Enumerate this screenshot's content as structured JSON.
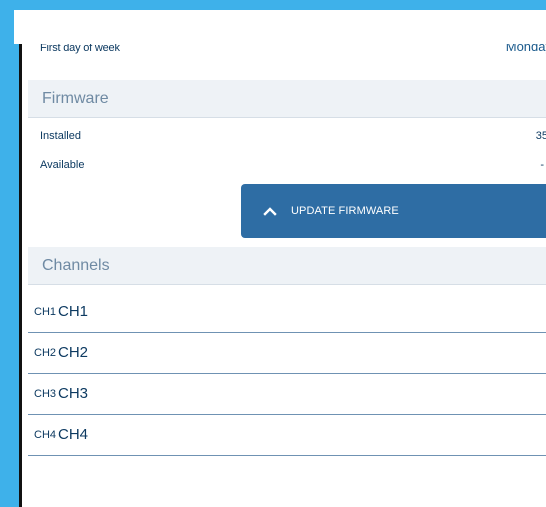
{
  "settings": {
    "first_day_label": "First day of week",
    "first_day_value": "Monday"
  },
  "firmware": {
    "title": "Firmware",
    "installed_label": "Installed",
    "installed_value": "35",
    "available_label": "Available",
    "available_value": "-",
    "update_button_label": "UPDATE FIRMWARE"
  },
  "channels": {
    "title": "Channels",
    "items": [
      {
        "id": "CH1",
        "name": "CH1"
      },
      {
        "id": "CH2",
        "name": "CH2"
      },
      {
        "id": "CH3",
        "name": "CH3"
      },
      {
        "id": "CH4",
        "name": "CH4"
      }
    ]
  },
  "colors": {
    "background": "#3eb1ea",
    "accent_button": "#2e6da4",
    "text_dark": "#0d3a61",
    "section_header_bg": "#eef2f6"
  },
  "icons": {
    "update_button_icon": "chevron-up-icon"
  }
}
